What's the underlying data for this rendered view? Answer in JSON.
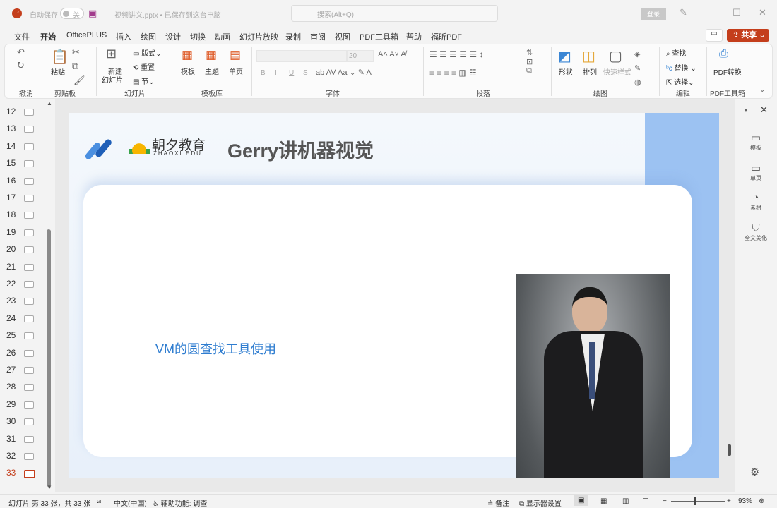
{
  "titlebar": {
    "autosave_label": "自动保存",
    "autosave_state": "关",
    "file_title": "视频讲义.pptx • 已保存到这台电脑",
    "search_placeholder": "搜索(Alt+Q)",
    "login": "登录"
  },
  "menu": {
    "tabs": [
      "文件",
      "开始",
      "OfficePLUS",
      "插入",
      "绘图",
      "设计",
      "切换",
      "动画",
      "幻灯片放映",
      "录制",
      "审阅",
      "视图",
      "PDF工具箱",
      "帮助",
      "福昕PDF"
    ],
    "share": "共享"
  },
  "ribbon": {
    "undo_group": "撤消",
    "clipboard": {
      "paste": "粘贴",
      "group": "剪贴板"
    },
    "slides": {
      "new_slide": "新建",
      "new_slide2": "幻灯片",
      "layout": "版式",
      "reset": "重置",
      "section": "节",
      "group": "幻灯片"
    },
    "templates": {
      "template": "模板",
      "theme": "主题",
      "single": "单页",
      "group": "模板库"
    },
    "font": {
      "size": "20",
      "bold": "B",
      "italic": "I",
      "underline": "U",
      "strike": "S",
      "group": "字体"
    },
    "paragraph": {
      "group": "段落"
    },
    "drawing": {
      "shape": "形状",
      "arrange": "排列",
      "quick_style": "快速样式",
      "group": "绘图"
    },
    "editing": {
      "find": "查找",
      "replace": "替换",
      "select": "选择",
      "group": "编辑"
    },
    "pdf": {
      "convert": "PDF转换",
      "group": "PDF工具箱"
    }
  },
  "thumbnails": {
    "numbers": [
      "12",
      "13",
      "14",
      "15",
      "16",
      "17",
      "18",
      "19",
      "20",
      "21",
      "22",
      "23",
      "24",
      "25",
      "26",
      "27",
      "28",
      "29",
      "30",
      "31",
      "32",
      "33"
    ],
    "selected": "33"
  },
  "slide": {
    "logo_cn": "朝夕教育",
    "logo_en": "ZHAOXI EDU",
    "headline": "Gerry讲机器视觉",
    "subtitle": "VM的圆查找工具使用"
  },
  "right_pane": {
    "items": [
      "模板",
      "单页",
      "素材",
      "全文美化"
    ]
  },
  "status": {
    "slide_info": "幻灯片 第 33 张，共 33 张",
    "language": "中文(中国)",
    "accessibility": "辅助功能: 调查",
    "notes": "备注",
    "display": "显示器设置",
    "zoom": "93%"
  },
  "colors": {
    "accent": "#c43e1c",
    "slide_blue": "#2f7dd0"
  }
}
